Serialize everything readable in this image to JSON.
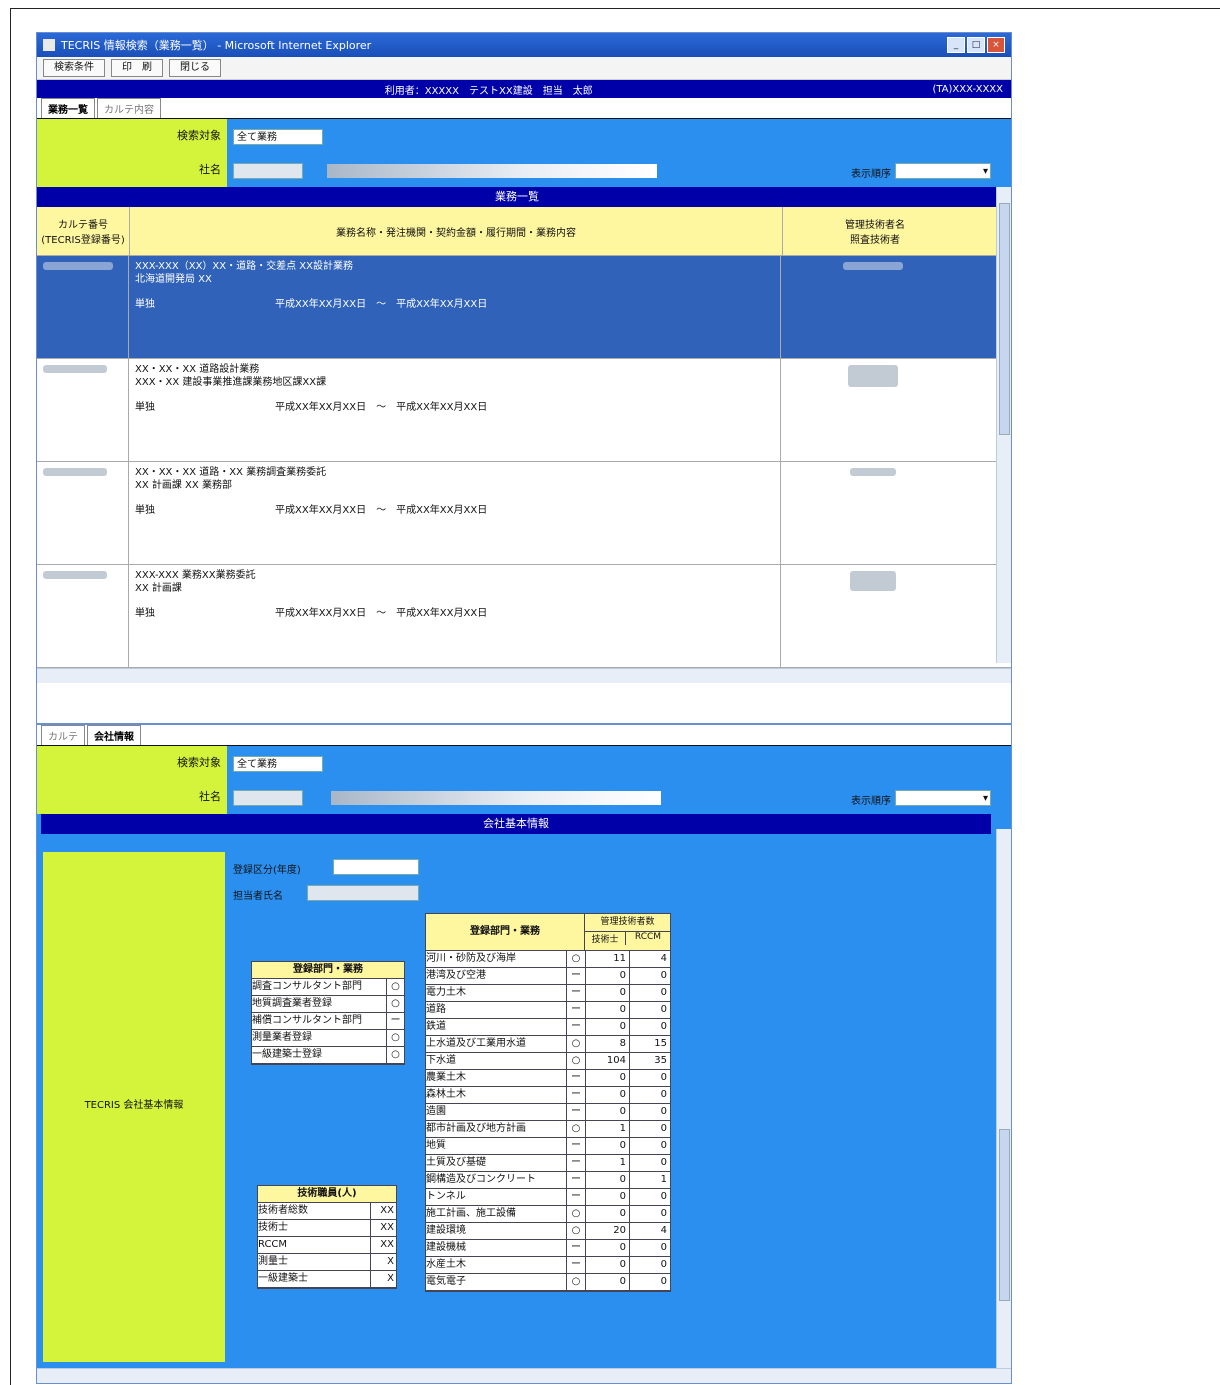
{
  "window": {
    "title": "TECRIS 情報検索（業務一覧） - Microsoft Internet Explorer",
    "toolbar": [
      "検索条件",
      "印　刷",
      "閉じる"
    ],
    "user_bar": {
      "center": "利用者：XXXXX　テストXX建設　担当　太郎",
      "right": "(TA)XXX-XXXX"
    }
  },
  "top": {
    "tabs": [
      "業務一覧",
      "カルテ内容"
    ],
    "search": {
      "label1": "検索対象",
      "value1": "全て業務",
      "label2": "社名",
      "label3": "表示順序"
    },
    "list_title": "業務一覧",
    "columns": [
      "カルテ番号\n(TECRIS登録番号)",
      "業務名称・発注機関・契約金額・履行期間・業務内容",
      "管理技術者名\n照査技術者"
    ],
    "rows": [
      {
        "line1": "XXX-XXX（XX）XX・道路・交差点 XX設計業務",
        "line2": "北海道開発局 XX",
        "kind": "単独",
        "period": "平成XX年XX月XX日　～　平成XX年XX月XX日"
      },
      {
        "line1": "XX・XX・XX 道路設計業務",
        "line2": "XXX・XX 建設事業推進課業務地区課XX課",
        "kind": "単独",
        "period": "平成XX年XX月XX日　～　平成XX年XX月XX日"
      },
      {
        "line1": "XX・XX・XX 道路・XX 業務調査業務委託",
        "line2": "XX 計画課 XX 業務部",
        "kind": "単独",
        "period": "平成XX年XX月XX日　～　平成XX年XX月XX日"
      },
      {
        "line1": "XXX-XXX 業務XX業務委託",
        "line2": "XX 計画課",
        "kind": "単独",
        "period": "平成XX年XX月XX日　～　平成XX年XX月XX日"
      }
    ]
  },
  "bottom": {
    "tabs": [
      "カルテ",
      "会社情報"
    ],
    "search": {
      "label1": "検索対象",
      "value1": "全て業務",
      "label2": "社名",
      "label3": "表示順序"
    },
    "section_title": "会社基本情報",
    "left_label": "TECRIS 会社基本情報",
    "field1": "登録区分(年度)",
    "field2": "担当者氏名",
    "dept_table": {
      "header": "登録部門・業務",
      "rows": [
        {
          "name": "調査コンサルタント部門",
          "check": "○"
        },
        {
          "name": "地質調査業者登録",
          "check": "○"
        },
        {
          "name": "補償コンサルタント部門",
          "check": "ー"
        },
        {
          "name": "測量業者登録",
          "check": "○"
        },
        {
          "name": "一級建築士登録",
          "check": "○"
        }
      ]
    },
    "staff_table": {
      "header": "技術職員(人)",
      "rows": [
        {
          "name": "技術者総数",
          "value": "XX"
        },
        {
          "name": "技術士",
          "value": "XX"
        },
        {
          "name": "RCCM",
          "value": "XX"
        },
        {
          "name": "測量士",
          "value": "X"
        },
        {
          "name": "一級建築士",
          "value": "X"
        }
      ]
    },
    "big_table": {
      "header": "登録部門・業務",
      "sub_header": "管理技術者数",
      "sub_cols": [
        "技術士",
        "RCCM"
      ],
      "rows": [
        {
          "name": "河川・砂防及び海岸",
          "check": "○",
          "a": "11",
          "b": "4"
        },
        {
          "name": "港湾及び空港",
          "check": "ー",
          "a": "0",
          "b": "0"
        },
        {
          "name": "電力土木",
          "check": "ー",
          "a": "0",
          "b": "0"
        },
        {
          "name": "道路",
          "check": "ー",
          "a": "0",
          "b": "0"
        },
        {
          "name": "鉄道",
          "check": "ー",
          "a": "0",
          "b": "0"
        },
        {
          "name": "上水道及び工業用水道",
          "check": "○",
          "a": "8",
          "b": "15"
        },
        {
          "name": "下水道",
          "check": "○",
          "a": "104",
          "b": "35"
        },
        {
          "name": "農業土木",
          "check": "ー",
          "a": "0",
          "b": "0"
        },
        {
          "name": "森林土木",
          "check": "ー",
          "a": "0",
          "b": "0"
        },
        {
          "name": "造園",
          "check": "ー",
          "a": "0",
          "b": "0"
        },
        {
          "name": "都市計画及び地方計画",
          "check": "○",
          "a": "1",
          "b": "0"
        },
        {
          "name": "地質",
          "check": "ー",
          "a": "0",
          "b": "0"
        },
        {
          "name": "土質及び基礎",
          "check": "ー",
          "a": "1",
          "b": "0"
        },
        {
          "name": "鋼構造及びコンクリート",
          "check": "ー",
          "a": "0",
          "b": "1"
        },
        {
          "name": "トンネル",
          "check": "ー",
          "a": "0",
          "b": "0"
        },
        {
          "name": "施工計画、施工設備",
          "check": "○",
          "a": "0",
          "b": "0"
        },
        {
          "name": "建設環境",
          "check": "○",
          "a": "20",
          "b": "4"
        },
        {
          "name": "建設機械",
          "check": "ー",
          "a": "0",
          "b": "0"
        },
        {
          "name": "水産土木",
          "check": "ー",
          "a": "0",
          "b": "0"
        },
        {
          "name": "電気電子",
          "check": "○",
          "a": "0",
          "b": "0"
        }
      ]
    }
  }
}
